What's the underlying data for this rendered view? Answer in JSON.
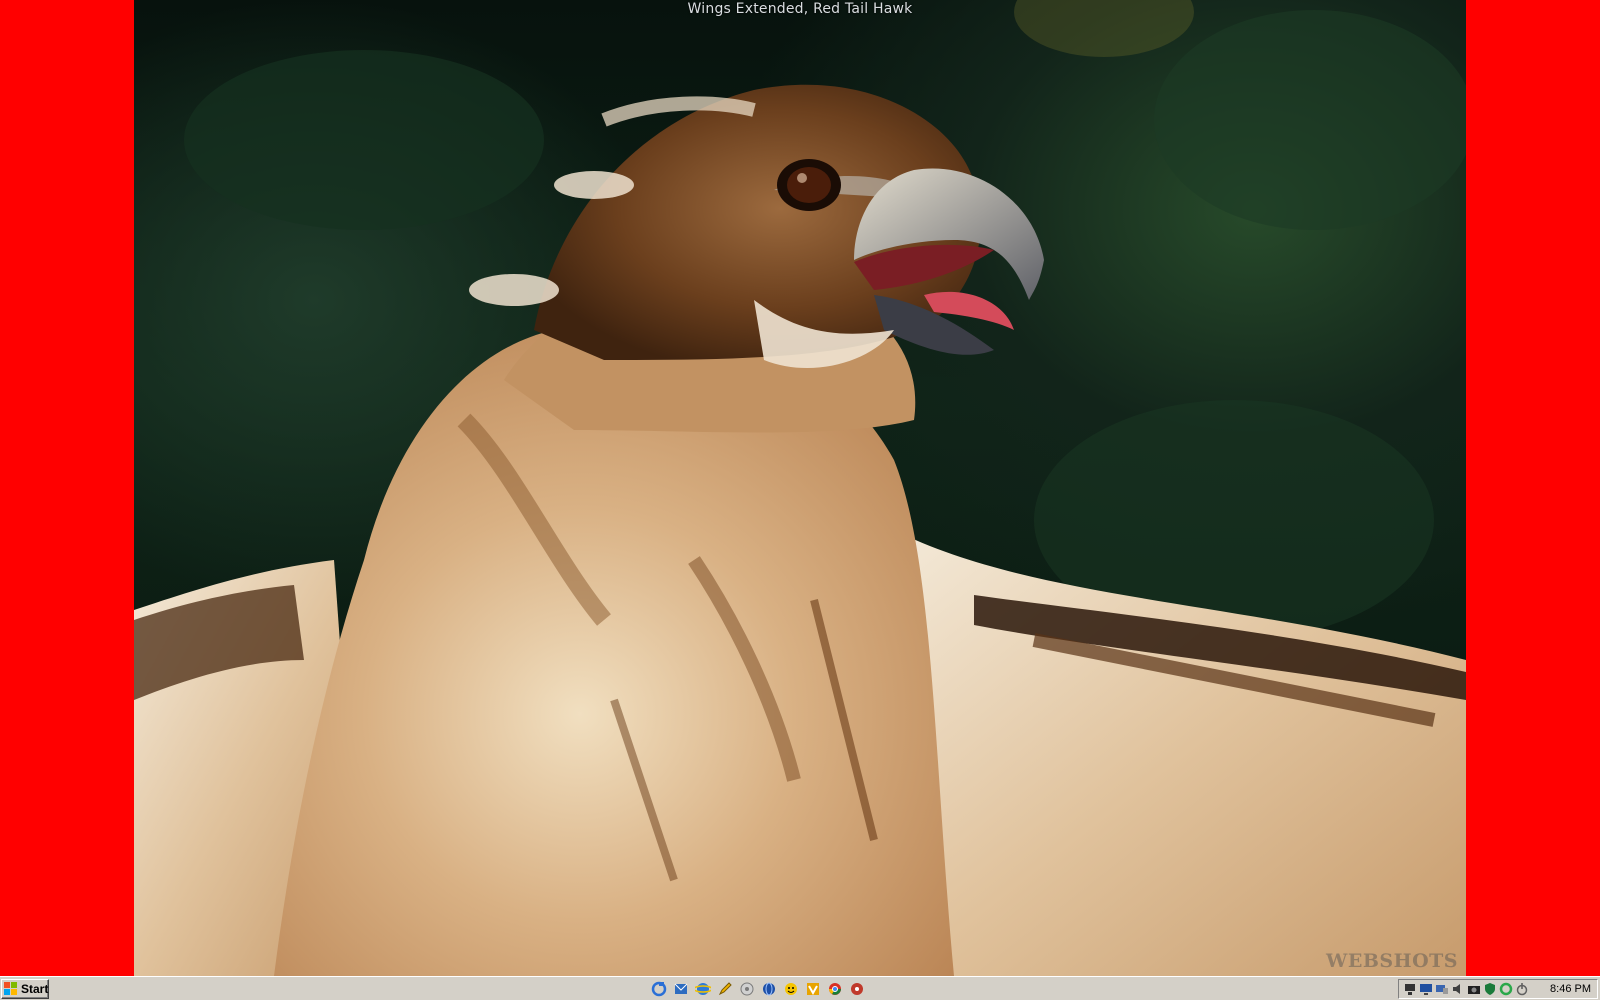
{
  "desktop": {
    "wallpaper_title": "Wings Extended, Red Tail Hawk",
    "watermark": "WEBSHOTS",
    "side_color": "#ff0000"
  },
  "taskbar": {
    "start_label": "Start",
    "quick_launch": [
      {
        "icon": "ie-refresh-icon",
        "color": "#2a6fd6"
      },
      {
        "icon": "outlook-icon",
        "color": "#2d6cc0"
      },
      {
        "icon": "internet-explorer-icon",
        "color": "#2e7bd8"
      },
      {
        "icon": "pencil-icon",
        "color": "#f0b400"
      },
      {
        "icon": "media-player-icon",
        "color": "#7a7a7a"
      },
      {
        "icon": "globe-icon",
        "color": "#1c4fa8"
      },
      {
        "icon": "messenger-smiley-icon",
        "color": "#f5c400"
      },
      {
        "icon": "winamp-icon",
        "color": "#e8a400"
      },
      {
        "icon": "chrome-icon",
        "color": "#d93025"
      },
      {
        "icon": "record-icon",
        "color": "#c0392b"
      }
    ],
    "tray_icons": [
      {
        "icon": "network-icon",
        "color": "#333333"
      },
      {
        "icon": "display-icon",
        "color": "#2050a0"
      },
      {
        "icon": "monitor-icon",
        "color": "#3a66b0"
      },
      {
        "icon": "volume-icon",
        "color": "#404040"
      },
      {
        "icon": "camera-icon",
        "color": "#202020"
      },
      {
        "icon": "antivirus-icon",
        "color": "#1a7a3a"
      },
      {
        "icon": "sync-icon",
        "color": "#2aa84a"
      },
      {
        "icon": "power-icon",
        "color": "#606060"
      }
    ],
    "clock": "8:46 PM"
  }
}
